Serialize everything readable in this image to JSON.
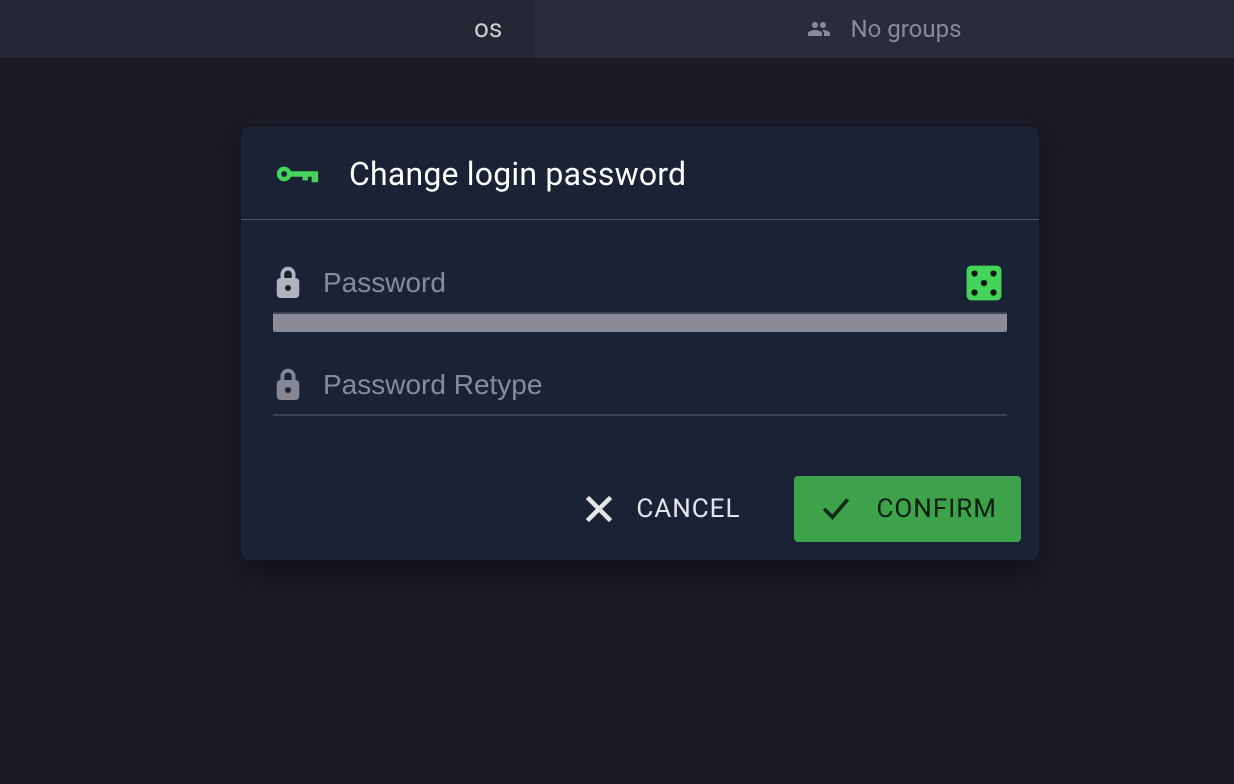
{
  "tabs": {
    "left_fragment": "os",
    "right_label": "No groups"
  },
  "modal": {
    "title": "Change login password",
    "password": {
      "placeholder": "Password",
      "value": ""
    },
    "retype": {
      "placeholder": "Password Retype",
      "value": ""
    },
    "actions": {
      "cancel": "CANCEL",
      "confirm": "CONFIRM"
    }
  },
  "icons": {
    "key": "key-icon",
    "people": "people-icon",
    "lock": "lock-icon",
    "dice": "dice-icon",
    "close": "close-icon",
    "check": "check-icon"
  }
}
